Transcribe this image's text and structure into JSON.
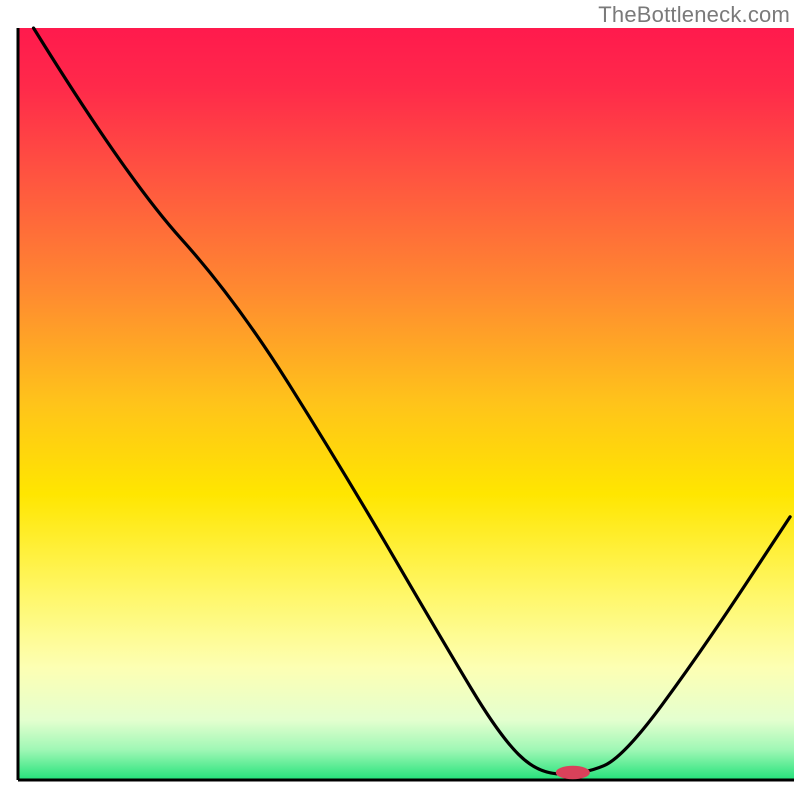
{
  "watermark": "TheBottleneck.com",
  "chart_data": {
    "type": "line",
    "title": "",
    "xlabel": "",
    "ylabel": "",
    "xlim": [
      0,
      100
    ],
    "ylim": [
      0,
      100
    ],
    "background_gradient_stops": [
      {
        "offset": 0.0,
        "color": "#ff1a4d"
      },
      {
        "offset": 0.08,
        "color": "#ff2a4a"
      },
      {
        "offset": 0.2,
        "color": "#ff5540"
      },
      {
        "offset": 0.35,
        "color": "#ff8a30"
      },
      {
        "offset": 0.5,
        "color": "#ffc41a"
      },
      {
        "offset": 0.62,
        "color": "#ffe600"
      },
      {
        "offset": 0.75,
        "color": "#fff766"
      },
      {
        "offset": 0.85,
        "color": "#fdffb3"
      },
      {
        "offset": 0.92,
        "color": "#e4ffcf"
      },
      {
        "offset": 0.96,
        "color": "#9ff7b5"
      },
      {
        "offset": 1.0,
        "color": "#23e27a"
      }
    ],
    "curve_points": [
      {
        "x": 2.0,
        "y": 100.0
      },
      {
        "x": 14.0,
        "y": 80.0
      },
      {
        "x": 28.0,
        "y": 64.0
      },
      {
        "x": 42.0,
        "y": 41.0
      },
      {
        "x": 55.0,
        "y": 18.0
      },
      {
        "x": 62.0,
        "y": 6.0
      },
      {
        "x": 67.0,
        "y": 0.8
      },
      {
        "x": 73.0,
        "y": 0.8
      },
      {
        "x": 78.0,
        "y": 3.0
      },
      {
        "x": 88.0,
        "y": 17.0
      },
      {
        "x": 99.5,
        "y": 35.0
      }
    ],
    "optimal_marker": {
      "x": 71.5,
      "y": 1.0,
      "rx": 2.2,
      "ry": 0.9,
      "color": "#d9415a"
    },
    "axis_color": "#000000",
    "axis_width": 3,
    "curve_color": "#000000",
    "curve_width": 3.2
  }
}
